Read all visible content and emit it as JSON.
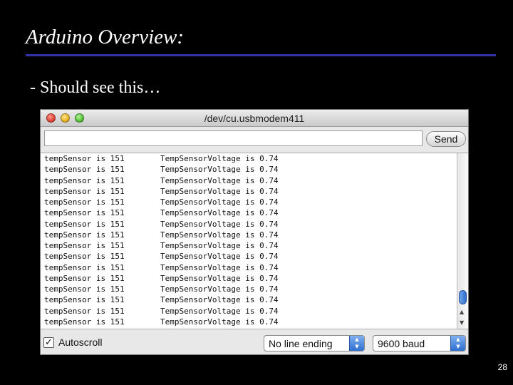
{
  "slide": {
    "title": "Arduino Overview:",
    "bullet": "- Should see this…",
    "page_number": "28"
  },
  "window": {
    "title": "/dev/cu.usbmodem411",
    "send_input": {
      "value": "",
      "placeholder": ""
    },
    "send_label": "Send",
    "output_lines": [
      {
        "sensor": "tempSensor is 151",
        "voltage": "TempSensorVoltage is 0.74"
      },
      {
        "sensor": "tempSensor is 151",
        "voltage": "TempSensorVoltage is 0.74"
      },
      {
        "sensor": "tempSensor is 151",
        "voltage": "TempSensorVoltage is 0.74"
      },
      {
        "sensor": "tempSensor is 151",
        "voltage": "TempSensorVoltage is 0.74"
      },
      {
        "sensor": "tempSensor is 151",
        "voltage": "TempSensorVoltage is 0.74"
      },
      {
        "sensor": "tempSensor is 151",
        "voltage": "TempSensorVoltage is 0.74"
      },
      {
        "sensor": "tempSensor is 151",
        "voltage": "TempSensorVoltage is 0.74"
      },
      {
        "sensor": "tempSensor is 151",
        "voltage": "TempSensorVoltage is 0.74"
      },
      {
        "sensor": "tempSensor is 151",
        "voltage": "TempSensorVoltage is 0.74"
      },
      {
        "sensor": "tempSensor is 151",
        "voltage": "TempSensorVoltage is 0.74"
      },
      {
        "sensor": "tempSensor is 151",
        "voltage": "TempSensorVoltage is 0.74"
      },
      {
        "sensor": "tempSensor is 151",
        "voltage": "TempSensorVoltage is 0.74"
      },
      {
        "sensor": "tempSensor is 151",
        "voltage": "TempSensorVoltage is 0.74"
      },
      {
        "sensor": "tempSensor is 151",
        "voltage": "TempSensorVoltage is 0.74"
      },
      {
        "sensor": "tempSensor is 151",
        "voltage": "TempSensorVoltage is 0.74"
      },
      {
        "sensor": "tempSensor is 151",
        "voltage": "TempSensorVoltage is 0.74"
      }
    ],
    "autoscroll": {
      "label": "Autoscroll",
      "checked": true,
      "check_glyph": "✓"
    },
    "line_ending": {
      "selected": "No line ending"
    },
    "baud": {
      "selected": "9600 baud"
    },
    "icons": {
      "close": "close-light-icon",
      "minimize": "minimize-light-icon",
      "zoom": "zoom-light-icon",
      "scroll_up": "▲",
      "scroll_down": "▼",
      "select_arrows": "▲\n▼"
    }
  },
  "colors": {
    "background": "#000000",
    "title_rule": "#3333aa",
    "scroll_thumb": "#2f6fd0"
  }
}
